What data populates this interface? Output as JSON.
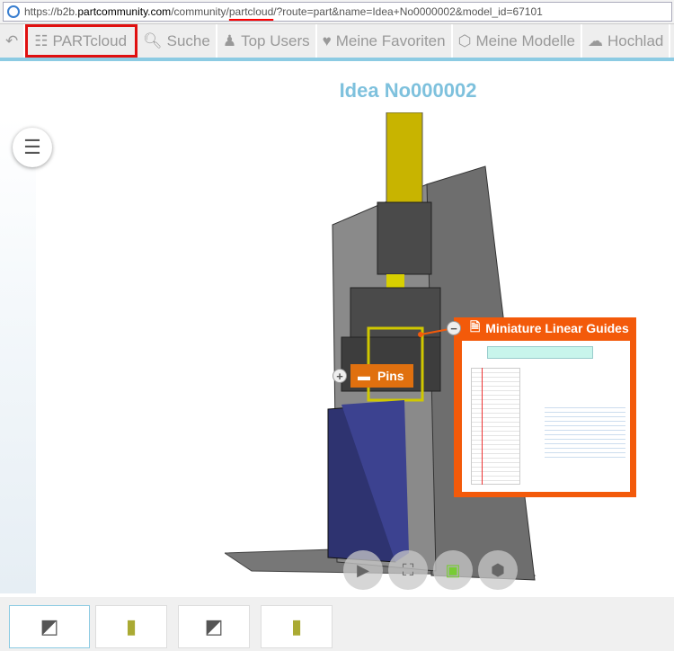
{
  "browser": {
    "url_prefix": "https://b2b.",
    "url_domain": "partcommunity.com",
    "url_mid": "/community/",
    "url_hl": "partcloud",
    "url_rest": "/?route=part&name=Idea+No0000002&model_id=67101"
  },
  "nav": {
    "back": "back",
    "items": [
      {
        "label": "PARTcloud",
        "icon": "grid-icon"
      },
      {
        "label": "Suche",
        "icon": "search-icon"
      },
      {
        "label": "Top Users",
        "icon": "users-icon"
      },
      {
        "label": "Meine Favoriten",
        "icon": "heart-icon"
      },
      {
        "label": "Meine Modelle",
        "icon": "cube-icon"
      },
      {
        "label": "Hochlad",
        "icon": "upload-icon"
      }
    ]
  },
  "page": {
    "title": "Idea No000002"
  },
  "annotations": {
    "pins": "Pins",
    "guides": "Miniature Linear Guides"
  },
  "controls": [
    "animation",
    "fit-view",
    "configurator",
    "render-mode"
  ],
  "colors": {
    "accent": "#8ccbe3",
    "title": "#7ec1dd",
    "pins": "#e0700f",
    "guides": "#f35a0a"
  }
}
